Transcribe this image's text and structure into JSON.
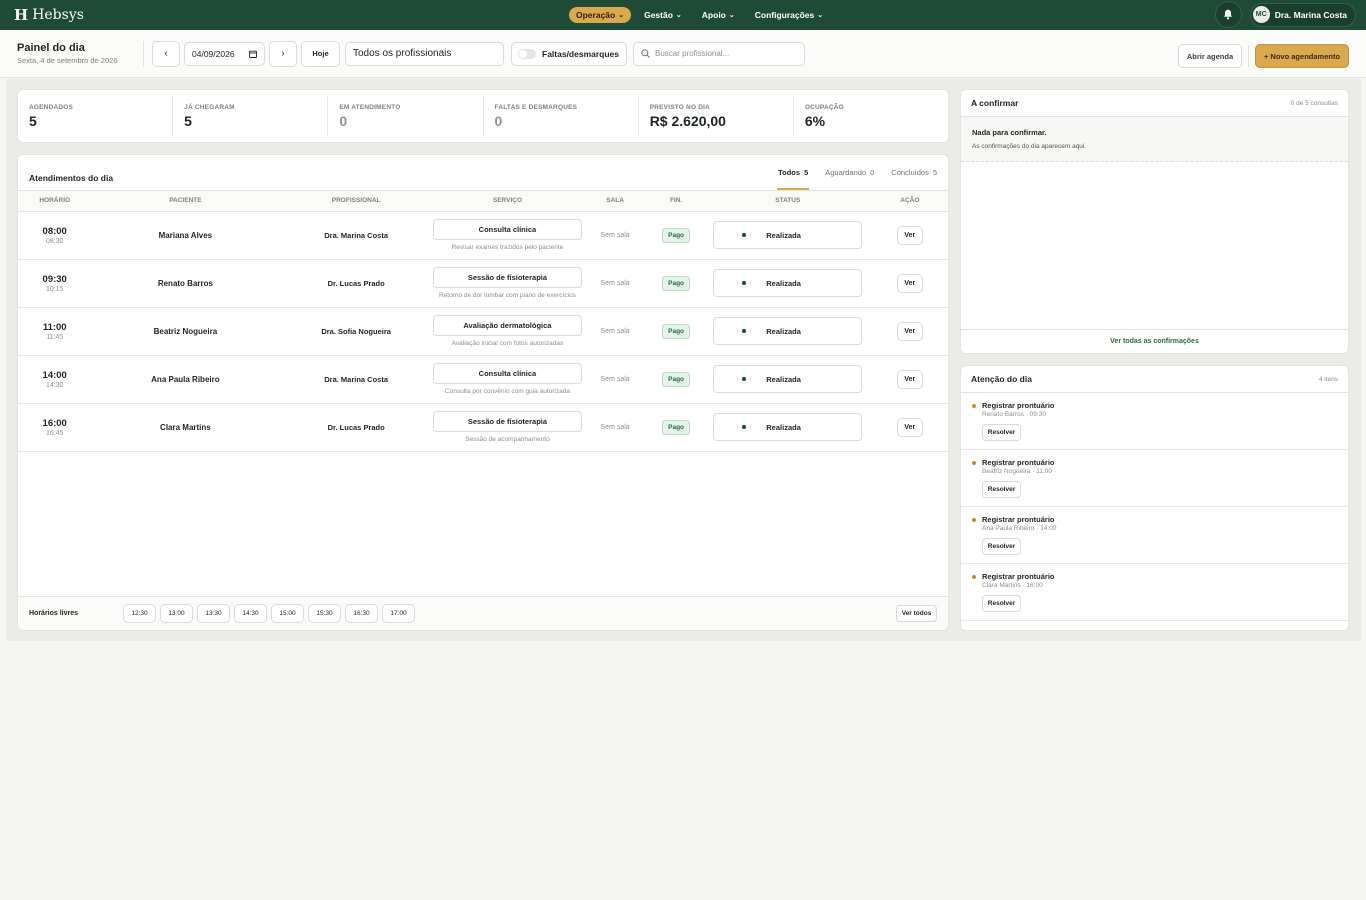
{
  "app": {
    "brand": "Hebsys",
    "brand_mark": "H"
  },
  "nav": {
    "items": [
      {
        "label": "Operação",
        "active": true
      },
      {
        "label": "Gestão",
        "active": false
      },
      {
        "label": "Apoio",
        "active": false
      },
      {
        "label": "Configurações",
        "active": false
      }
    ],
    "user": {
      "initials": "MC",
      "name": "Dra. Marina Costa"
    }
  },
  "toolbar": {
    "title": "Painel do dia",
    "subtitle": "Sexta, 4 de setembro de 2026",
    "prev_label": "‹",
    "next_label": "›",
    "date_value": "04/09/2026",
    "today_label": "Hoje",
    "professional_select": "Todos os profissionais",
    "toggle_label": "Faltas/desmarques",
    "search_placeholder": "Buscar profissional...",
    "open_agenda_label": "Abrir agenda",
    "new_appointment_label": "+ Novo agendamento"
  },
  "stats": [
    {
      "label": "AGENDADOS",
      "value": "5",
      "muted": false
    },
    {
      "label": "JÁ CHEGARAM",
      "value": "5",
      "muted": false
    },
    {
      "label": "EM ATENDIMENTO",
      "value": "0",
      "muted": true
    },
    {
      "label": "FALTAS E DESMARQUES",
      "value": "0",
      "muted": true
    },
    {
      "label": "PREVISTO NO DIA",
      "value": "R$ 2.620,00",
      "muted": false
    },
    {
      "label": "OCUPAÇÃO",
      "value": "6%",
      "muted": false
    }
  ],
  "appointments": {
    "title": "Atendimentos do dia",
    "tabs": [
      {
        "label": "Todos",
        "count": "5",
        "active": true
      },
      {
        "label": "Aguardando",
        "count": "0",
        "active": false
      },
      {
        "label": "Concluídos",
        "count": "5",
        "active": false
      }
    ],
    "columns": [
      "HORÁRIO",
      "PACIENTE",
      "PROFISSIONAL",
      "SERVIÇO",
      "SALA",
      "FIN.",
      "STATUS",
      "AÇÃO"
    ],
    "rows": [
      {
        "start": "08:00",
        "end": "08:30",
        "patient": "Mariana Alves",
        "professional": "Dra. Marina Costa",
        "service": "Consulta clínica",
        "note": "Revisar exames trazidos pelo paciente",
        "room": "Sem sala",
        "fin": "Pago",
        "status": "Realizada",
        "action": "Ver"
      },
      {
        "start": "09:30",
        "end": "10:15",
        "patient": "Renato Barros",
        "professional": "Dr. Lucas Prado",
        "service": "Sessão de fisioterapia",
        "note": "Retorno de dor lombar com plano de exercícios",
        "room": "Sem sala",
        "fin": "Pago",
        "status": "Realizada",
        "action": "Ver"
      },
      {
        "start": "11:00",
        "end": "11:45",
        "patient": "Beatriz Nogueira",
        "professional": "Dra. Sofia Nogueira",
        "service": "Avaliação dermatológica",
        "note": "Avaliação inicial com fotos autorizadas",
        "room": "Sem sala",
        "fin": "Pago",
        "status": "Realizada",
        "action": "Ver"
      },
      {
        "start": "14:00",
        "end": "14:30",
        "patient": "Ana Paula Ribeiro",
        "professional": "Dra. Marina Costa",
        "service": "Consulta clínica",
        "note": "Consulta por convênio com guia autorizada",
        "room": "Sem sala",
        "fin": "Pago",
        "status": "Realizada",
        "action": "Ver"
      },
      {
        "start": "16:00",
        "end": "16:45",
        "patient": "Clara Martins",
        "professional": "Dr. Lucas Prado",
        "service": "Sessão de fisioterapia",
        "note": "Sessão de acompanhamento",
        "room": "Sem sala",
        "fin": "Pago",
        "status": "Realizada",
        "action": "Ver"
      }
    ],
    "free_slots_label": "Horários livres",
    "free_slots": [
      "12:30",
      "13:00",
      "13:30",
      "14:30",
      "15:00",
      "15:30",
      "16:30",
      "17:00"
    ],
    "see_all_label": "Ver todos"
  },
  "confirm": {
    "title": "A confirmar",
    "meta": "0 de 5 consultas",
    "empty_title": "Nada para confirmar.",
    "empty_sub": "As confirmações do dia aparecem aqui.",
    "footer_link": "Ver todas as confirmações"
  },
  "attention": {
    "title": "Atenção do dia",
    "meta": "4 itens",
    "items": [
      {
        "title": "Registrar prontuário",
        "sub": "Renato Barros · 09:30",
        "action": "Resolver"
      },
      {
        "title": "Registrar prontuário",
        "sub": "Beatriz Nogueira · 11:00",
        "action": "Resolver"
      },
      {
        "title": "Registrar prontuário",
        "sub": "Ana Paula Ribeiro · 14:00",
        "action": "Resolver"
      },
      {
        "title": "Registrar prontuário",
        "sub": "Clara Martins · 16:00",
        "action": "Resolver"
      }
    ]
  },
  "colors": {
    "brand_green": "#1f4a35",
    "accent_gold": "#d9a84f",
    "paid_green": "#2b6b3e"
  }
}
